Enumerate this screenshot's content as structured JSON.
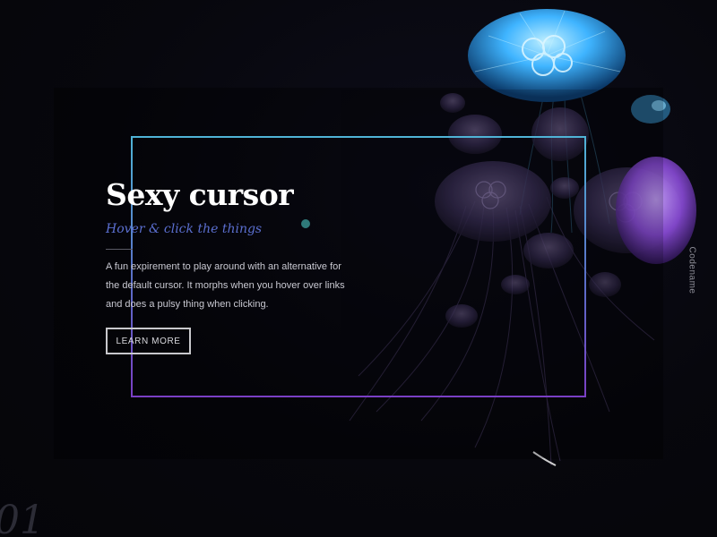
{
  "hero": {
    "title": "Sexy cursor",
    "subtitle": "Hover & click the things",
    "description": "A fun expirement to play around with an alternative for the default cursor. It morphs when you hover over links and does a pulsy thing when clicking.",
    "cta_label": "LEARN MORE"
  },
  "side_label": "Codename",
  "slide_number": "01",
  "colors": {
    "background": "#07070d",
    "title": "#ffffff",
    "subtitle": "#5b6fd0",
    "frame_top": "#4fb3d6",
    "frame_bottom": "#7a3fc4",
    "cursor_dot": "#2f7a7a",
    "jelly_bright": "#3fb4ff",
    "jelly_purple": "#8a4bd8"
  },
  "icons": {
    "cursor": "cursor-dot-icon"
  }
}
